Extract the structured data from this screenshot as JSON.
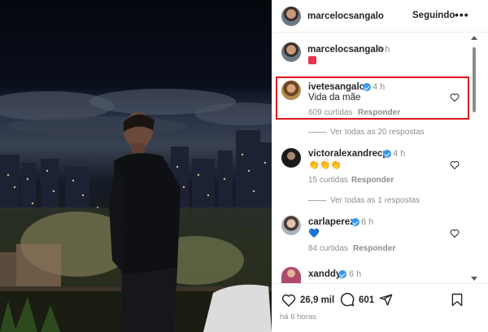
{
  "post": {
    "author": "marcelocsangalo",
    "follow_label": "Seguindo",
    "more_label": "•••",
    "caption_author": "marcelocsangalo",
    "caption_time": "6 h"
  },
  "comments": [
    {
      "username": "ivetesangalo",
      "verified": true,
      "time": "4 h",
      "text": "Vida da mãe",
      "likes": "609 curtidas",
      "reply_label": "Responder",
      "view_replies": "Ver todas as 20 respostas"
    },
    {
      "username": "victoralexandrecp",
      "verified": true,
      "time": "4 h",
      "text": "👏👏👏",
      "likes": "15 curtidas",
      "reply_label": "Responder",
      "view_replies": "Ver todas as 1 respostas"
    },
    {
      "username": "carlaperez",
      "verified": true,
      "time": "6 h",
      "text": "💙",
      "likes": "84 curtidas",
      "reply_label": "Responder"
    },
    {
      "username": "xanddy",
      "verified": true,
      "time": "6 h"
    }
  ],
  "actions": {
    "likes_count": "26,9 mil",
    "comments_count": "601",
    "posted_ago": "há 6 horas"
  },
  "colors": {
    "highlight": "#e0161d",
    "verified": "#3897f0",
    "muted_text": "#8e8e8e"
  }
}
